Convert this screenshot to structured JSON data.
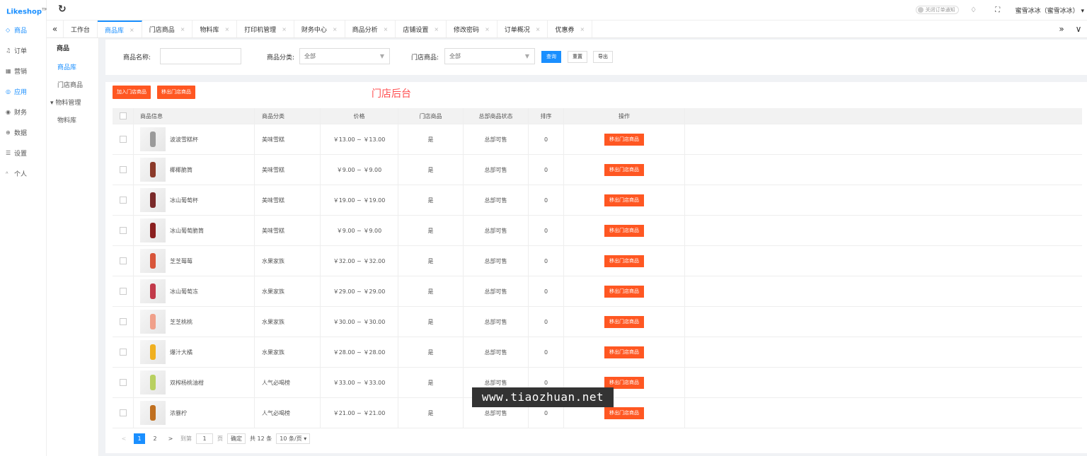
{
  "app": {
    "logo": "Likeshop",
    "logo_mark": "TM"
  },
  "nav": [
    {
      "icon": "diamond-icon",
      "glyph": "◇",
      "label": "商品",
      "active": true
    },
    {
      "icon": "bell-icon",
      "glyph": "♫",
      "label": "订单",
      "active": false
    },
    {
      "icon": "grid-icon",
      "glyph": "▦",
      "label": "营销",
      "active": false
    },
    {
      "icon": "check-circle-icon",
      "glyph": "◎",
      "label": "应用",
      "active": true
    },
    {
      "icon": "wallet-icon",
      "glyph": "◉",
      "label": "财务",
      "active": false
    },
    {
      "icon": "globe-icon",
      "glyph": "⊕",
      "label": "数据",
      "active": false
    },
    {
      "icon": "settings-icon",
      "glyph": "☰",
      "label": "设置",
      "active": false
    },
    {
      "icon": "user-icon",
      "glyph": "ᴬ",
      "label": "个人",
      "active": false
    }
  ],
  "subnav": {
    "title": "商品",
    "items": [
      {
        "label": "商品库",
        "active": true
      },
      {
        "label": "门店商品",
        "active": false
      }
    ],
    "group": {
      "label": "物料管理",
      "items": [
        "物料库"
      ]
    }
  },
  "topbar": {
    "refresh_icon": "↻",
    "toggle_label": "关闭订单通知",
    "bell_glyph": "♢",
    "fullscreen_glyph": "⛶",
    "user": "蜜雪冰冰（蜜雪冰冰）",
    "dropdown_glyph": "▾"
  },
  "tabs": {
    "left_arrow": "«",
    "right_arrow": "»",
    "more": "∨",
    "home": "工作台",
    "items": [
      {
        "label": "商品库",
        "active": true
      },
      {
        "label": "门店商品",
        "active": false
      },
      {
        "label": "物料库",
        "active": false
      },
      {
        "label": "打印机管理",
        "active": false
      },
      {
        "label": "财务中心",
        "active": false
      },
      {
        "label": "商品分析",
        "active": false
      },
      {
        "label": "店铺设置",
        "active": false
      },
      {
        "label": "修改密码",
        "active": false
      },
      {
        "label": "订单概况",
        "active": false
      },
      {
        "label": "优惠券",
        "active": false
      }
    ],
    "close_glyph": "×"
  },
  "filter": {
    "name_label": "商品名称:",
    "name_value": "",
    "category_label": "商品分类:",
    "category_value": "全部",
    "store_label": "门店商品:",
    "store_value": "全部",
    "query": "查询",
    "reset": "重置",
    "export": "导出"
  },
  "actions": {
    "add": "加入门店商品",
    "remove": "移出门店商品"
  },
  "overlay_label": "门店后台",
  "table": {
    "headers": [
      "商品信息",
      "商品分类",
      "价格",
      "门店商品",
      "总部商品状态",
      "排序",
      "操作"
    ],
    "action_label": "移出门店商品",
    "rows": [
      {
        "name": "波波雪糕杯",
        "category": "美味雪糕",
        "price": "￥13.00 ~ ￥13.00",
        "store": "是",
        "status": "总部可售",
        "sort": "0",
        "color": "#9a9a9a"
      },
      {
        "name": "椰椰脆筒",
        "category": "美味雪糕",
        "price": "￥9.00 ~ ￥9.00",
        "store": "是",
        "status": "总部可售",
        "sort": "0",
        "color": "#8b3a2a"
      },
      {
        "name": "冰山葡萄杯",
        "category": "美味雪糕",
        "price": "￥19.00 ~ ￥19.00",
        "store": "是",
        "status": "总部可售",
        "sort": "0",
        "color": "#7a2a2a"
      },
      {
        "name": "冰山葡萄脆筒",
        "category": "美味雪糕",
        "price": "￥9.00 ~ ￥9.00",
        "store": "是",
        "status": "总部可售",
        "sort": "0",
        "color": "#8b2020"
      },
      {
        "name": "芝芝莓莓",
        "category": "水果家族",
        "price": "￥32.00 ~ ￥32.00",
        "store": "是",
        "status": "总部可售",
        "sort": "0",
        "color": "#d8553a"
      },
      {
        "name": "冰山葡萄冻",
        "category": "水果家族",
        "price": "￥29.00 ~ ￥29.00",
        "store": "是",
        "status": "总部可售",
        "sort": "0",
        "color": "#c23a4a"
      },
      {
        "name": "芝芝桃桃",
        "category": "水果家族",
        "price": "￥30.00 ~ ￥30.00",
        "store": "是",
        "status": "总部可售",
        "sort": "0",
        "color": "#f0a08a"
      },
      {
        "name": "爆汁大橘",
        "category": "水果家族",
        "price": "￥28.00 ~ ￥28.00",
        "store": "是",
        "status": "总部可售",
        "sort": "0",
        "color": "#f0b020"
      },
      {
        "name": "双榨杨桃油柑",
        "category": "人气必喝榜",
        "price": "￥33.00 ~ ￥33.00",
        "store": "是",
        "status": "总部可售",
        "sort": "0",
        "color": "#b8d060"
      },
      {
        "name": "浓暴柠",
        "category": "人气必喝榜",
        "price": "￥21.00 ~ ￥21.00",
        "store": "是",
        "status": "总部可售",
        "sort": "0",
        "color": "#c07020"
      }
    ]
  },
  "pager": {
    "prev": "<",
    "next": ">",
    "pages": [
      "1",
      "2"
    ],
    "goto": "到第",
    "goto_value": "1",
    "page_unit": "页",
    "confirm": "确定",
    "total": "共 12 条",
    "size": "10 条/页"
  },
  "site_watermark": "www.tiaozhuan.net",
  "colors": {
    "accent": "#1a8fff",
    "danger": "#ff5722"
  }
}
